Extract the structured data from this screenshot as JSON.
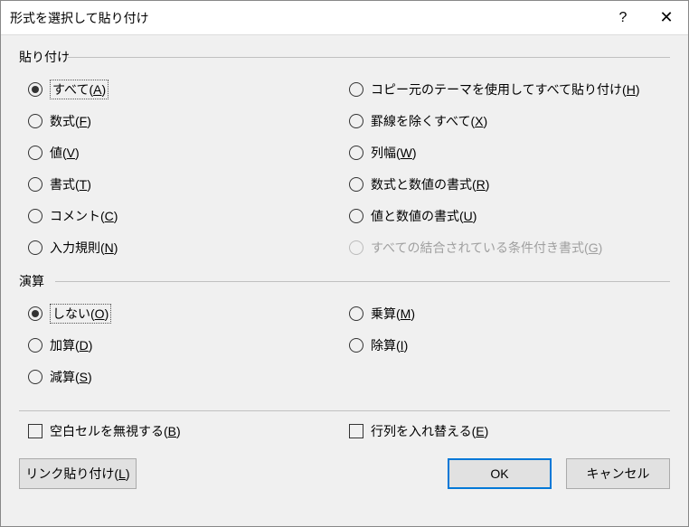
{
  "titlebar": {
    "title": "形式を選択して貼り付け",
    "help": "?",
    "close": "✕"
  },
  "groups": {
    "paste": {
      "label": "貼り付け",
      "left": [
        {
          "text": "すべて",
          "key": "A",
          "selected": true
        },
        {
          "text": "数式",
          "key": "F"
        },
        {
          "text": "値",
          "key": "V"
        },
        {
          "text": "書式",
          "key": "T"
        },
        {
          "text": "コメント",
          "key": "C"
        },
        {
          "text": "入力規則",
          "key": "N"
        }
      ],
      "right": [
        {
          "text": "コピー元のテーマを使用してすべて貼り付け",
          "key": "H"
        },
        {
          "text": "罫線を除くすべて",
          "key": "X"
        },
        {
          "text": "列幅",
          "key": "W"
        },
        {
          "text": "数式と数値の書式",
          "key": "R"
        },
        {
          "text": "値と数値の書式",
          "key": "U"
        },
        {
          "text": "すべての結合されている条件付き書式",
          "key": "G",
          "disabled": true
        }
      ]
    },
    "operation": {
      "label": "演算",
      "left": [
        {
          "text": "しない",
          "key": "O",
          "selected": true
        },
        {
          "text": "加算",
          "key": "D"
        },
        {
          "text": "減算",
          "key": "S"
        }
      ],
      "right": [
        {
          "text": "乗算",
          "key": "M"
        },
        {
          "text": "除算",
          "key": "I"
        }
      ]
    }
  },
  "checkboxes": {
    "skipBlanks": {
      "text": "空白セルを無視する",
      "key": "B"
    },
    "transpose": {
      "text": "行列を入れ替える",
      "key": "E"
    }
  },
  "buttons": {
    "linkPaste": {
      "text": "リンク貼り付け",
      "key": "L"
    },
    "ok": "OK",
    "cancel": "キャンセル"
  }
}
